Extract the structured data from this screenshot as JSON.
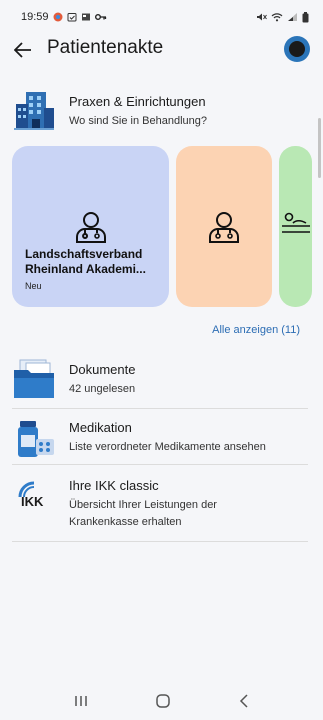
{
  "status_bar": {
    "time": "19:59"
  },
  "app_bar": {
    "title": "Patientenakte"
  },
  "facilities": {
    "title": "Praxen & Einrichtungen",
    "subtitle": "Wo sind Sie in Behandlung?",
    "cards": [
      {
        "line1": "Landschaftsverband",
        "line2": "Rheinland Akademi...",
        "badge": "Neu",
        "color": "#c9d4f5"
      },
      {
        "color": "#fcd3b3"
      },
      {
        "color": "#b9e8b4"
      }
    ],
    "show_all": "Alle anzeigen (11)"
  },
  "list": [
    {
      "title": "Dokumente",
      "subtitle": "42 ungelesen",
      "icon": "folder-documents-icon"
    },
    {
      "title": "Medikation",
      "subtitle": "Liste verordneter Medikamente ansehen",
      "icon": "medication-icon"
    },
    {
      "title": "Ihre IKK classic",
      "subtitle": "Übersicht Ihrer Leistungen der Krankenkasse erhalten",
      "icon": "ikk-logo-icon",
      "logo_text": "IKK"
    }
  ],
  "colors": {
    "accent": "#2c6db4",
    "background": "#f5f6f9"
  }
}
